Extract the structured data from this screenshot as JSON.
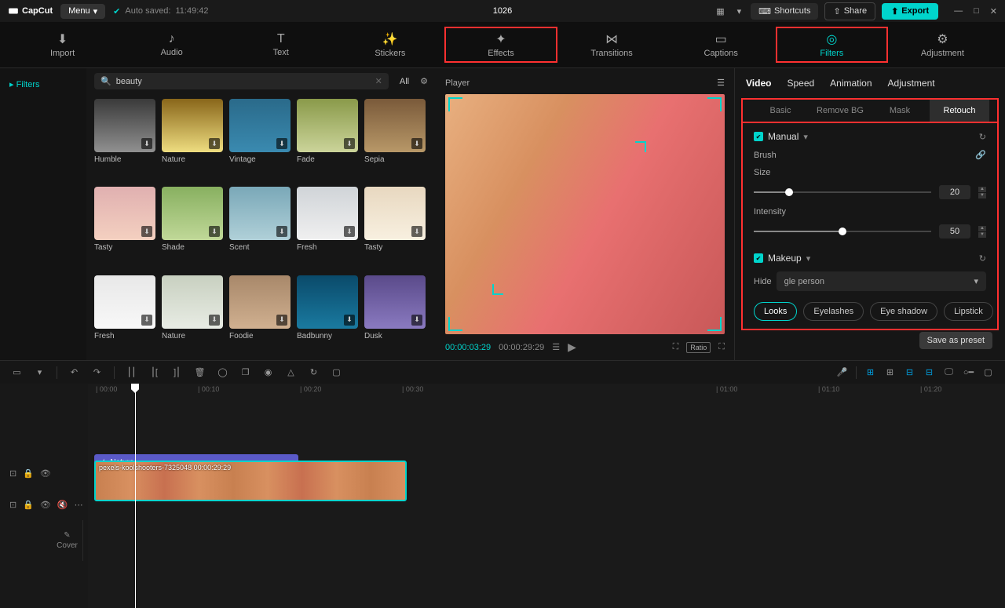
{
  "app": {
    "name": "CapCut",
    "menu_label": "Menu",
    "autosave_label": "Auto saved:",
    "autosave_time": "11:49:42",
    "project_title": "1026"
  },
  "topbar": {
    "shortcuts": "Shortcuts",
    "share": "Share",
    "export": "Export"
  },
  "media_tabs": [
    "Import",
    "Audio",
    "Text",
    "Stickers",
    "Effects",
    "Transitions",
    "Captions",
    "Filters",
    "Adjustment"
  ],
  "sidebar": {
    "filters_label": "Filters"
  },
  "search": {
    "placeholder": "Search",
    "query": "beauty",
    "all_label": "All"
  },
  "filters": [
    {
      "label": "Humble",
      "c": "th-humble"
    },
    {
      "label": "Nature",
      "c": "th-nature"
    },
    {
      "label": "Vintage",
      "c": "th-vintage"
    },
    {
      "label": "Fade",
      "c": "th-fade"
    },
    {
      "label": "Sepia",
      "c": "th-sepia"
    },
    {
      "label": "Tasty",
      "c": "th-tasty"
    },
    {
      "label": "Shade",
      "c": "th-shade"
    },
    {
      "label": "Scent",
      "c": "th-scent"
    },
    {
      "label": "Fresh",
      "c": "th-fresh"
    },
    {
      "label": "Tasty",
      "c": "th-tasty2"
    },
    {
      "label": "Fresh",
      "c": "th-fresh2"
    },
    {
      "label": "Nature",
      "c": "th-nature2"
    },
    {
      "label": "Foodie",
      "c": "th-foodie"
    },
    {
      "label": "Badbunny",
      "c": "th-badbunny"
    },
    {
      "label": "Dusk",
      "c": "th-dusk"
    }
  ],
  "player": {
    "title": "Player",
    "time_current": "00:00:03:29",
    "time_total": "00:00:29:29",
    "ratio": "Ratio"
  },
  "inspector": {
    "tabs": [
      "Video",
      "Speed",
      "Animation",
      "Adjustment"
    ],
    "subtabs": [
      "Basic",
      "Remove BG",
      "Mask",
      "Retouch"
    ],
    "manual": {
      "title": "Manual",
      "brush": "Brush",
      "size_label": "Size",
      "size_value": "20",
      "intensity_label": "Intensity",
      "intensity_value": "50"
    },
    "makeup": {
      "title": "Makeup",
      "hide_label": "Hide",
      "dropdown_value": "gle person",
      "chips": [
        "Looks",
        "Eyelashes",
        "Eye shadow",
        "Lipstick"
      ]
    },
    "save_preset": "Save as preset"
  },
  "timeline": {
    "ruler": [
      "00:00",
      "00:10",
      "00:20",
      "00:30",
      "01:00",
      "01:10",
      "01:20"
    ],
    "nature_clip": "Nature",
    "video_clip": "pexels-koolshooters-7325048  00:00:29:29",
    "cover": "Cover"
  }
}
